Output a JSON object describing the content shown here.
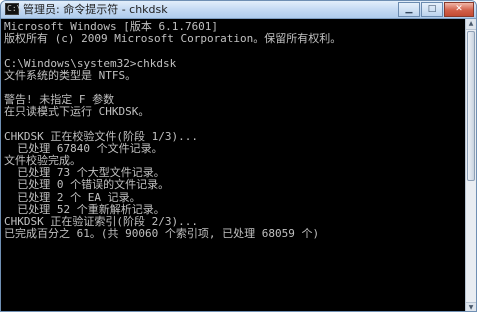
{
  "window": {
    "title": "管理员: 命令提示符 - chkdsk",
    "icon": "console-icon",
    "buttons": {
      "minimize": "minimize-icon",
      "maximize": "maximize-icon",
      "close": "close-icon"
    }
  },
  "console": {
    "lines": [
      "Microsoft Windows [版本 6.1.7601]",
      "版权所有 (c) 2009 Microsoft Corporation。保留所有权利。",
      "",
      "C:\\Windows\\system32>chkdsk",
      "文件系统的类型是 NTFS。",
      "",
      "警告! 未指定 F 参数",
      "在只读模式下运行 CHKDSK。",
      "",
      "CHKDSK 正在校验文件(阶段 1/3)...",
      "  已处理 67840 个文件记录。",
      "文件校验完成。",
      "  已处理 73 个大型文件记录。",
      "  已处理 0 个错误的文件记录。",
      "  已处理 2 个 EA 记录。",
      "  已处理 52 个重新解析记录。",
      "CHKDSK 正在验证索引(阶段 2/3)...",
      "已完成百分之 61。(共 90060 个索引项, 已处理 68059 个)"
    ]
  },
  "colors": {
    "console_bg": "#000000",
    "console_fg": "#c0c0c0"
  }
}
